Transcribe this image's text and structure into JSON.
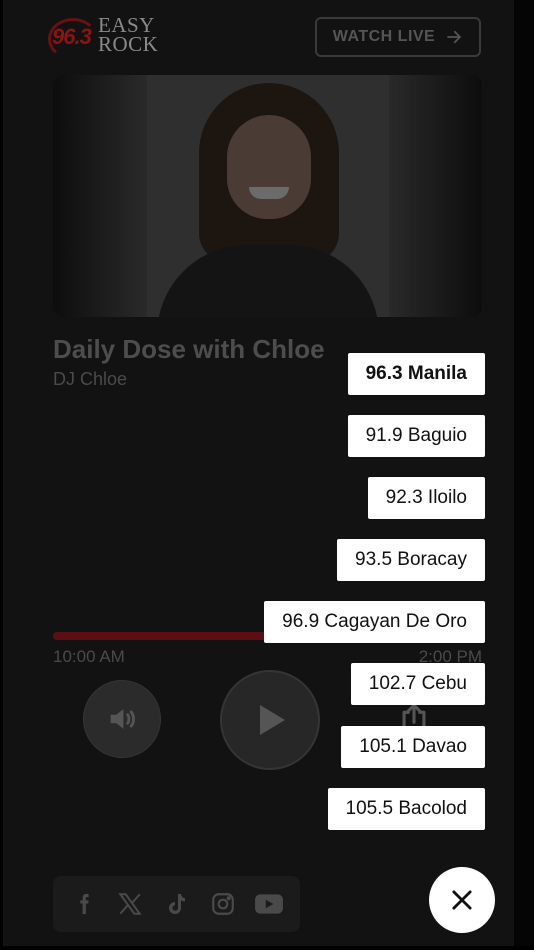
{
  "brand": {
    "logo_number": "96.3",
    "logo_word_top": "EASY",
    "logo_word_bottom": "ROCK"
  },
  "header": {
    "watch_live_label": "WATCH LIVE"
  },
  "now_playing": {
    "show_title": "Daily Dose with Chloe",
    "dj": "DJ Chloe",
    "time_start": "10:00 AM",
    "time_end": "2:00 PM",
    "progress": 0.5
  },
  "stations": [
    {
      "label": "96.3 Manila",
      "active": true
    },
    {
      "label": "91.9 Baguio",
      "active": false
    },
    {
      "label": "92.3 Iloilo",
      "active": false
    },
    {
      "label": "93.5 Boracay",
      "active": false
    },
    {
      "label": "96.9 Cagayan De Oro",
      "active": false
    },
    {
      "label": "102.7 Cebu",
      "active": false
    },
    {
      "label": "105.1 Davao",
      "active": false
    },
    {
      "label": "105.5 Bacolod",
      "active": false
    }
  ],
  "social_icons": [
    "facebook-icon",
    "x-icon",
    "tiktok-icon",
    "instagram-icon",
    "youtube-icon"
  ],
  "colors": {
    "accent": "#8a1414",
    "overlay_button": "#ffffff"
  }
}
